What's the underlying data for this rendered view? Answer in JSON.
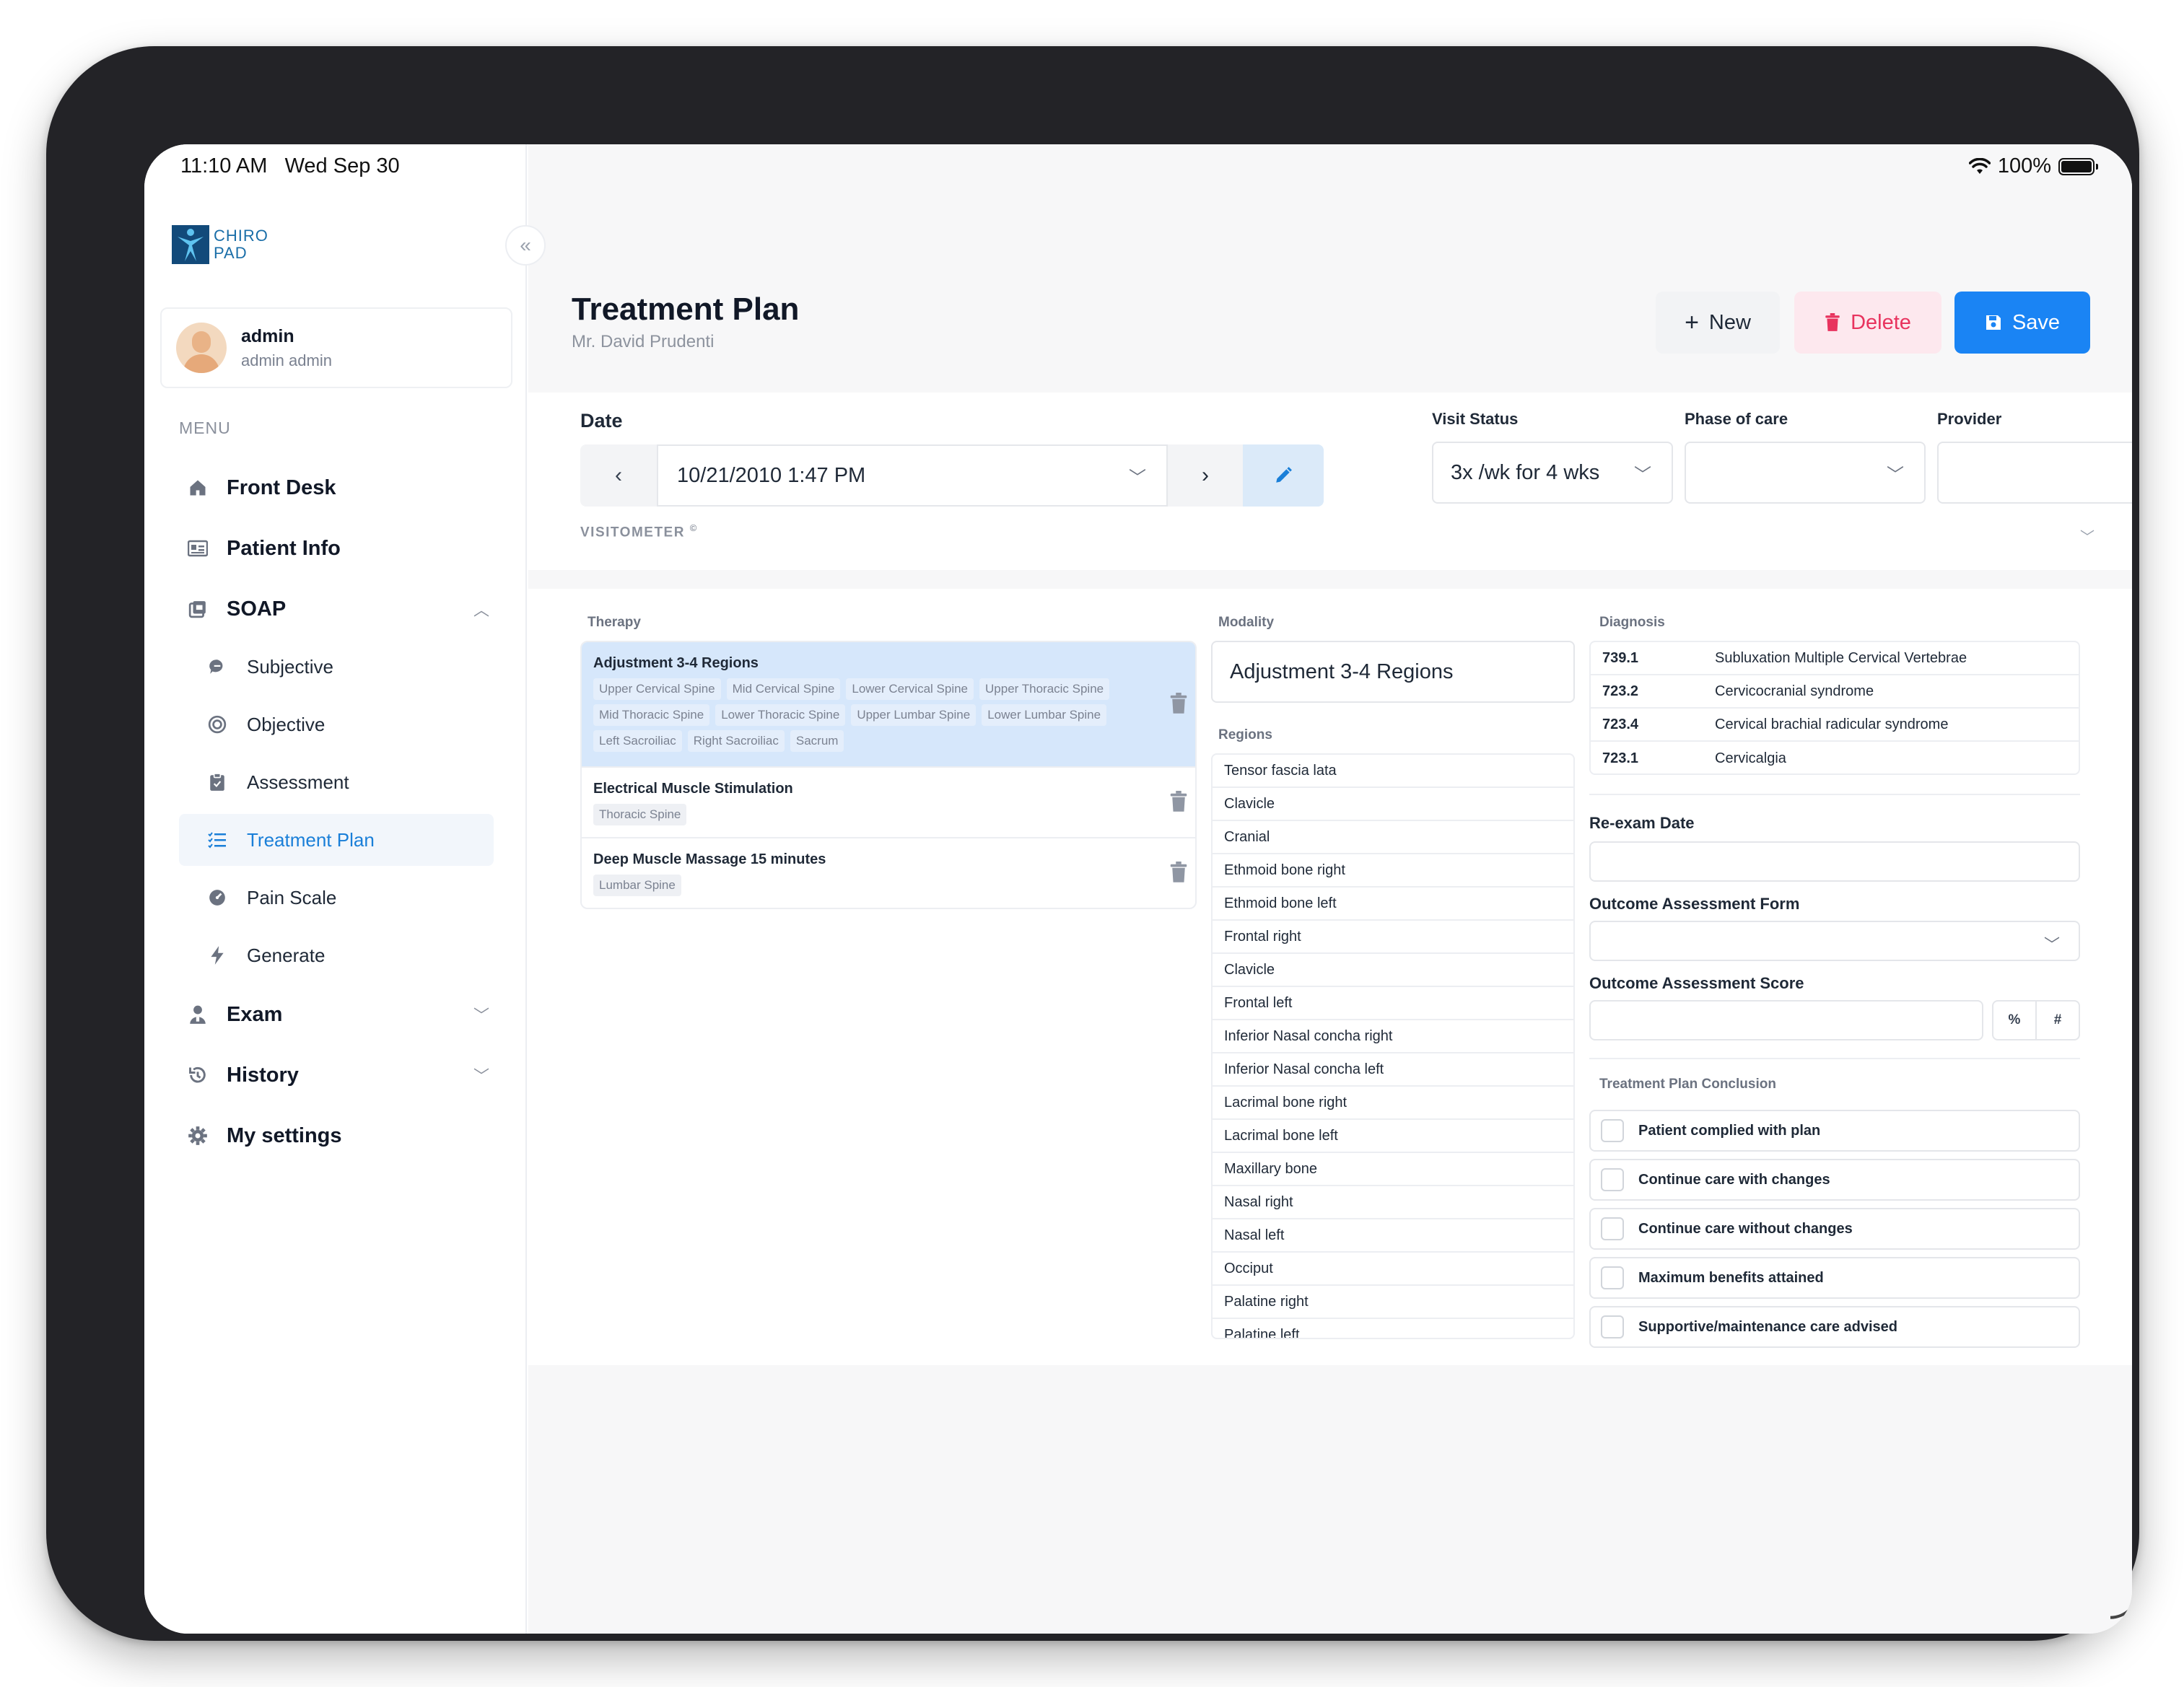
{
  "status_bar": {
    "time": "11:10 AM",
    "date": "Wed Sep 30",
    "battery": "100%"
  },
  "brand": {
    "line1": "CHIRO",
    "line2": "PAD"
  },
  "user": {
    "name": "admin",
    "role": "admin admin"
  },
  "menu": {
    "label": "MENU",
    "items": [
      {
        "label": "Front Desk",
        "icon": "home-icon"
      },
      {
        "label": "Patient Info",
        "icon": "id-card-icon"
      },
      {
        "label": "SOAP",
        "icon": "soap-icon",
        "expanded": true
      },
      {
        "label": "Exam",
        "icon": "doctor-icon"
      },
      {
        "label": "History",
        "icon": "history-icon"
      },
      {
        "label": "My settings",
        "icon": "gear-icon"
      }
    ],
    "soap_sub": [
      {
        "label": "Subjective",
        "icon": "chat-icon"
      },
      {
        "label": "Objective",
        "icon": "target-icon"
      },
      {
        "label": "Assessment",
        "icon": "clipboard-icon"
      },
      {
        "label": "Treatment Plan",
        "icon": "list-icon",
        "active": true
      },
      {
        "label": "Pain Scale",
        "icon": "gauge-icon"
      },
      {
        "label": "Generate",
        "icon": "bolt-icon"
      }
    ]
  },
  "header": {
    "title": "Treatment Plan",
    "patient": "Mr. David Prudenti",
    "new_label": "New",
    "delete_label": "Delete",
    "save_label": "Save"
  },
  "visit": {
    "date_label": "Date",
    "date_value": "10/21/2010 1:47 PM",
    "status_label": "Visit Status",
    "status_value": "3x /wk for 4 wks",
    "phase_label": "Phase of care",
    "phase_value": "",
    "provider_label": "Provider",
    "provider_value": "",
    "visitometer": "VISITOMETER",
    "visitometer_mark": "©"
  },
  "therapy": {
    "label": "Therapy",
    "items": [
      {
        "title": "Adjustment 3-4 Regions",
        "selected": true,
        "tags": [
          "Upper Cervical Spine",
          "Mid Cervical Spine",
          "Lower Cervical Spine",
          "Upper Thoracic Spine",
          "Mid Thoracic Spine",
          "Lower Thoracic Spine",
          "Upper Lumbar Spine",
          "Lower Lumbar Spine",
          "Left Sacroiliac",
          "Right Sacroiliac",
          "Sacrum"
        ]
      },
      {
        "title": "Electrical Muscle Stimulation",
        "selected": false,
        "tags": [
          "Thoracic Spine"
        ]
      },
      {
        "title": "Deep Muscle Massage 15 minutes",
        "selected": false,
        "tags": [
          "Lumbar Spine"
        ]
      }
    ]
  },
  "modality": {
    "label": "Modality",
    "value": "Adjustment 3-4 Regions"
  },
  "regions": {
    "label": "Regions",
    "items": [
      "Tensor fascia lata",
      "Clavicle",
      "Cranial",
      "Ethmoid bone right",
      "Ethmoid bone left",
      "Frontal right",
      "Clavicle",
      "Frontal left",
      "Inferior Nasal concha right",
      "Inferior Nasal concha left",
      "Lacrimal bone right",
      "Lacrimal bone left",
      "Maxillary bone",
      "Nasal right",
      "Nasal left",
      "Occiput",
      "Palatine right",
      "Palatine left"
    ]
  },
  "diagnosis": {
    "label": "Diagnosis",
    "rows": [
      {
        "code": "739.1",
        "desc": "Subluxation Multiple Cervical Vertebrae"
      },
      {
        "code": "723.2",
        "desc": "Cervicocranial syndrome"
      },
      {
        "code": "723.4",
        "desc": "Cervical brachial radicular syndrome"
      },
      {
        "code": "723.1",
        "desc": "Cervicalgia"
      }
    ]
  },
  "reexam": {
    "label": "Re-exam Date",
    "value": ""
  },
  "outcome_form": {
    "label": "Outcome Assessment Form",
    "value": ""
  },
  "outcome_score": {
    "label": "Outcome Assessment Score",
    "value": "",
    "percent": "%",
    "hash": "#"
  },
  "conclusion": {
    "label": "Treatment Plan Conclusion",
    "options": [
      "Patient complied with plan",
      "Continue care with changes",
      "Continue care without changes",
      "Maximum benefits attained",
      "Supportive/maintenance care advised"
    ]
  },
  "colors": {
    "accent": "#1a84f4",
    "danger": "#e8335e",
    "selected_row": "#d6e7fb"
  }
}
